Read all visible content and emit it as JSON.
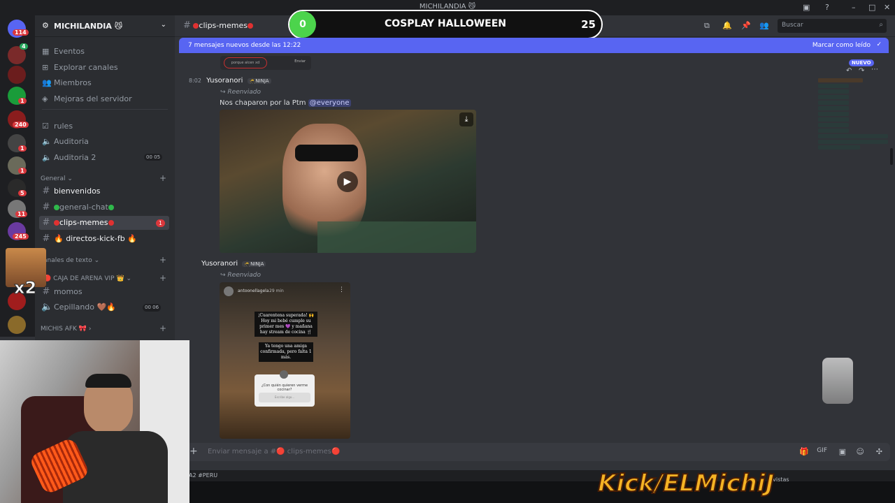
{
  "window": {
    "title": "MICHILANDIA 😼"
  },
  "overlay": {
    "counter_left": "0",
    "title": "COSPLAY HALLOWEEN",
    "counter_right": "25",
    "brand": "Kick/ELMichiJ",
    "multiplier": "x2"
  },
  "rail": {
    "badges": [
      "114",
      "4",
      "1",
      "1",
      "240",
      "1",
      "1",
      "5",
      "11",
      "245"
    ]
  },
  "server": {
    "name": "MICHILANDIA 😼"
  },
  "nav": [
    {
      "label": "Eventos",
      "icon": "calendar-icon"
    },
    {
      "label": "Explorar canales",
      "icon": "browse-icon"
    },
    {
      "label": "Miembros",
      "icon": "members-icon"
    },
    {
      "label": "Mejoras del servidor",
      "icon": "boost-icon"
    }
  ],
  "channels_top": [
    {
      "label": "rules",
      "icon": "rules-icon"
    },
    {
      "label": "Auditoria",
      "icon": "speaker-icon"
    },
    {
      "label": "Auditoria 2",
      "icon": "speaker-icon",
      "users": "00",
      "limit": "05"
    }
  ],
  "categories": {
    "general": "General",
    "text": "anales de texto",
    "vip": "CAJA DE ARENA VIP",
    "afk": "MICHIS AFK"
  },
  "channels_general": [
    {
      "label": "bienvenidos"
    },
    {
      "label": "general-chat"
    },
    {
      "label": "clips-memes",
      "badge": "1"
    },
    {
      "label": "🔥 directos-kick-fb 🔥"
    }
  ],
  "channels_vip": [
    {
      "label": "momos"
    },
    {
      "label": "Cepillando 🤎🔥",
      "users": "00",
      "limit": "06"
    }
  ],
  "header": {
    "channel": "clips-memes",
    "search_placeholder": "Buscar"
  },
  "banner": {
    "text": "7 mensajes nuevos desde las 12:22",
    "action": "Marcar como leído"
  },
  "messages": [
    {
      "time": "8:02",
      "user": "Yusoranori",
      "tag": "🥷NINJA",
      "forwarded": "Reenviado",
      "text": "Nos chaparon por la Ptm",
      "mention": "@everyone"
    },
    {
      "user": "Yusoranori",
      "tag": "🥷NINJA",
      "forwarded": "Reenviado",
      "story": {
        "author": "antoonellagela",
        "age": "29 min",
        "caption1": "¡Cuarentena superada! 🙌 Hoy mi bebé cumple su primer mes 💜 y mañana hay stream de cocina 🍴",
        "caption2": "Ya tengo una amiga confirmada, pero falta 1 más.",
        "question": "¿Con quién quieren verme cocinar?",
        "answer_placeholder": "Escribe algo..."
      }
    }
  ],
  "prev_attachment": {
    "text": "porque alcen xd",
    "send": "Enviar"
  },
  "composer": {
    "placeholder": "Enviar mensaje a #🔴 clips-memes🔴"
  },
  "footer": {
    "left": "A2 #PERU",
    "right": "k vistas"
  },
  "new_badge": "NUEVO",
  "colors": {
    "accent": "#5865f2",
    "unread_red": "#da373c",
    "online_green": "#2fb84b"
  }
}
